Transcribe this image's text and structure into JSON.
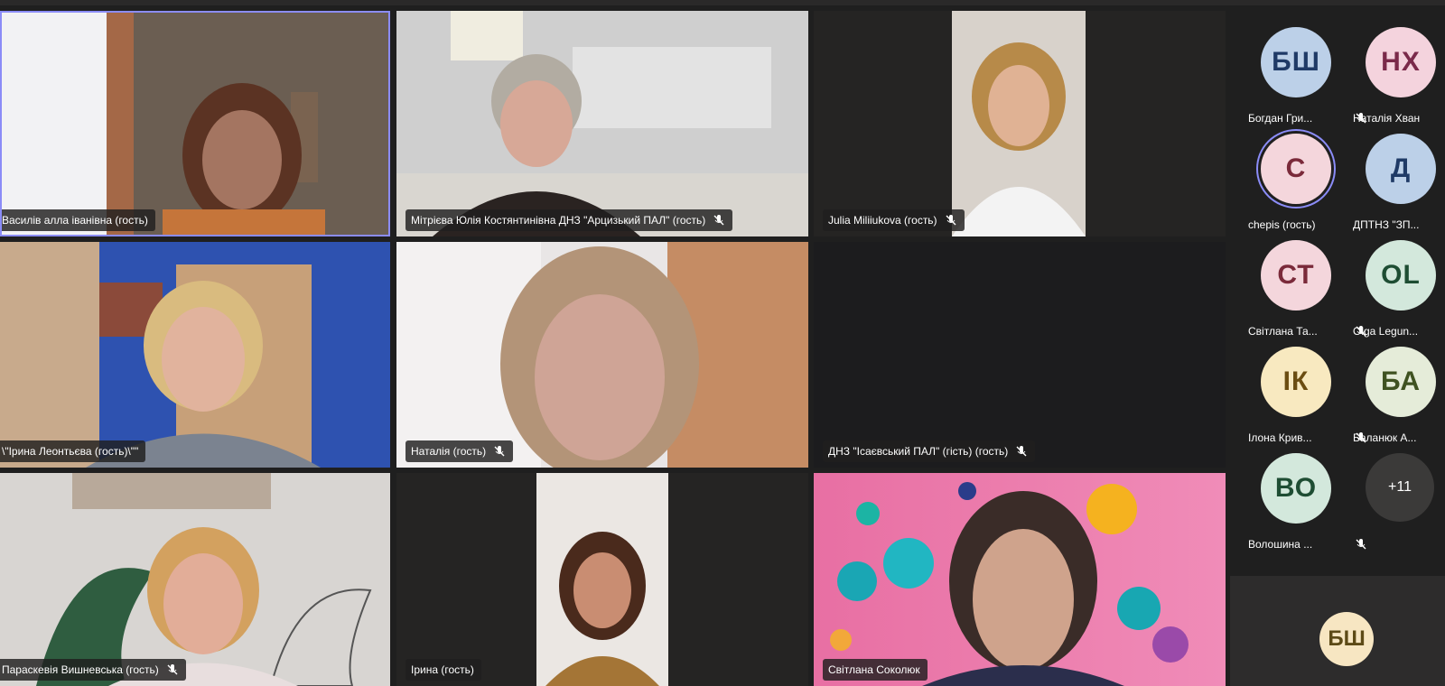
{
  "tiles": [
    {
      "name": "Василів алла іванівна (гость)"
    },
    {
      "name": "Мітрієва Юлія Костянтинівна ДНЗ \"Арцизький ПАЛ\" (гость)"
    },
    {
      "name": "Julia Miliiukova (гость)"
    },
    {
      "name": "\\\"Ірина Леонтьєва (гость)\\\"\""
    },
    {
      "name": "Наталія (гость)"
    },
    {
      "name": "ДНЗ \"Ісаєвський ПАЛ\" (гість) (гость)"
    },
    {
      "name": "Параскевія Вишневська (гость)"
    },
    {
      "name": "Ірина (гость)"
    },
    {
      "name": "Світлана Соколюк"
    }
  ],
  "participants": [
    {
      "initials": "БШ",
      "name": "Богдан Гри..."
    },
    {
      "initials": "НХ",
      "name": "Наталія Хван"
    },
    {
      "initials": "С",
      "name": "chepis (гость)"
    },
    {
      "initials": "Д",
      "name": "ДПТНЗ \"ЗП..."
    },
    {
      "initials": "СТ",
      "name": "Світлана Та..."
    },
    {
      "initials": "OL",
      "name": "Olga Legun..."
    },
    {
      "initials": "ІК",
      "name": "Ілона Крив..."
    },
    {
      "initials": "БА",
      "name": "Баланюк А..."
    },
    {
      "initials": "ВО",
      "name": "Волошина ..."
    }
  ],
  "more_count": "+11",
  "self": {
    "initials": "БШ"
  },
  "colors": {
    "accent": "#8b8cf7",
    "stage_bg": "#1f1f1f",
    "tile_bg": "#252423"
  }
}
